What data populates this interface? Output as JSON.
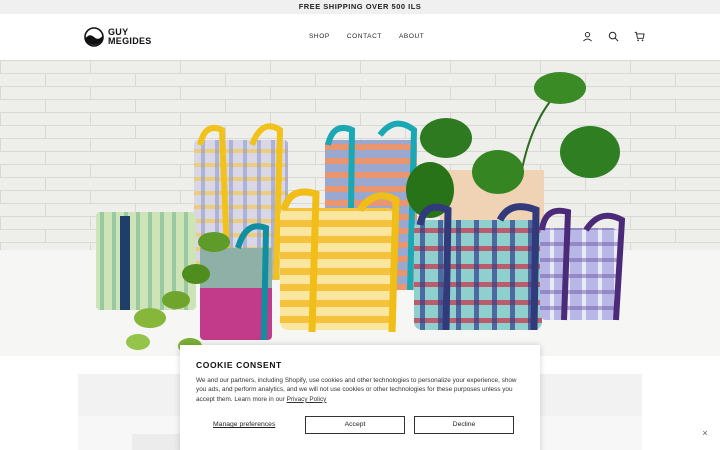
{
  "announcement": {
    "text": "FREE SHIPPING OVER 500 ILS"
  },
  "header": {
    "logo_line1": "GUY",
    "logo_line2": "MEGIDES",
    "nav": [
      "SHOP",
      "CONTACT",
      "ABOUT"
    ],
    "icons": [
      "account-icon",
      "search-icon",
      "cart-icon"
    ]
  },
  "hero": {
    "image": "woven mesh storage baskets with plants"
  },
  "cookie": {
    "title": "COOKIE CONSENT",
    "body": "We and our partners, including Shopify, use cookies and other technologies to personalize your experience, show you ads, and perform analytics, and we will not use cookies or other technologies for these purposes unless you accept them. Learn more in our ",
    "privacy_link": "Privacy Policy",
    "manage_label": "Manage preferences",
    "accept_label": "Accept",
    "decline_label": "Decline"
  },
  "close_glyph": "×",
  "colors": {
    "announce_bg": "#f0f0f0",
    "text": "#1a1a1a",
    "hero_bg": "#ebebe8"
  }
}
